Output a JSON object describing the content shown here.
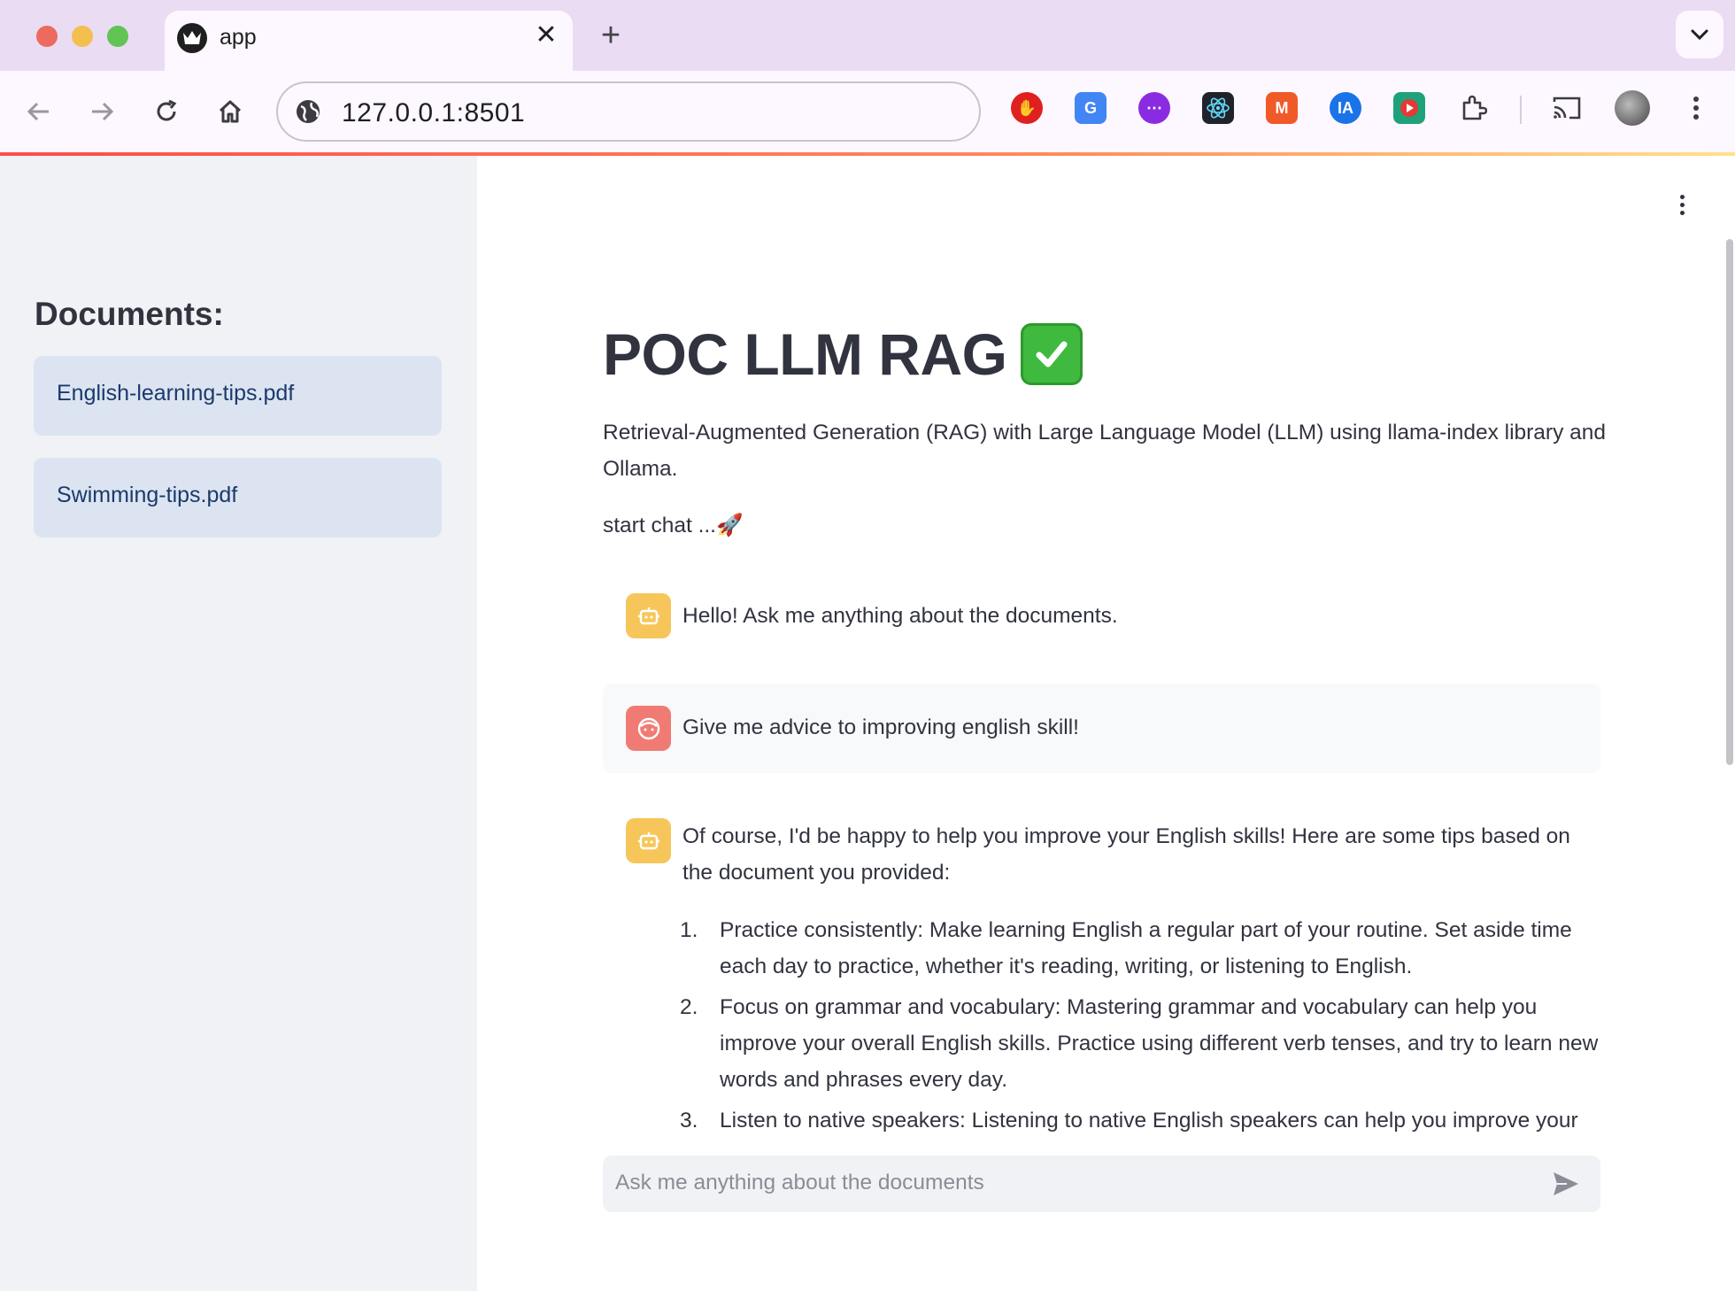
{
  "browser": {
    "tab_title": "app",
    "tab_close": "✕",
    "new_tab": "+",
    "url": "127.0.0.1:8501"
  },
  "sidebar": {
    "heading": "Documents:",
    "documents": [
      "English-learning-tips.pdf",
      "Swimming-tips.pdf"
    ]
  },
  "main": {
    "title": "POC LLM RAG",
    "description": "Retrieval-Augmented Generation (RAG) with Large Language Model (LLM) using llama-index library and Ollama.",
    "start_text": "start chat ...🚀",
    "messages": [
      {
        "role": "assistant",
        "text": "Hello! Ask me anything about the documents."
      },
      {
        "role": "user",
        "text": "Give me advice to improving english skill!"
      },
      {
        "role": "assistant",
        "text": "Of course, I'd be happy to help you improve your English skills! Here are some tips based on the document you provided:"
      }
    ],
    "tips": [
      {
        "num": "1.",
        "text": "Practice consistently: Make learning English a regular part of your routine. Set aside time each day to practice, whether it's reading, writing, or listening to English."
      },
      {
        "num": "2.",
        "text": "Focus on grammar and vocabulary: Mastering grammar and vocabulary can help you improve your overall English skills. Practice using different verb tenses, and try to learn new words and phrases every day."
      },
      {
        "num": "3.",
        "text": "Listen to native speakers: Listening to native English speakers can help you improve your"
      }
    ],
    "chat_placeholder": "Ask me anything about the documents"
  },
  "colors": {
    "accent": "#ff4b4b",
    "sidebar_bg": "#f0f2f6",
    "doc_item_bg": "#dce4f1",
    "bot_avatar": "#f7c65a",
    "user_avatar": "#f07b74"
  },
  "icons": [
    "back-arrow-icon",
    "forward-arrow-icon",
    "reload-icon",
    "home-icon",
    "site-info-icon",
    "chevron-down-icon",
    "more-vert-icon",
    "robot-icon",
    "face-icon",
    "send-icon",
    "check-mark-icon",
    "cast-icon",
    "extensions-icon"
  ]
}
